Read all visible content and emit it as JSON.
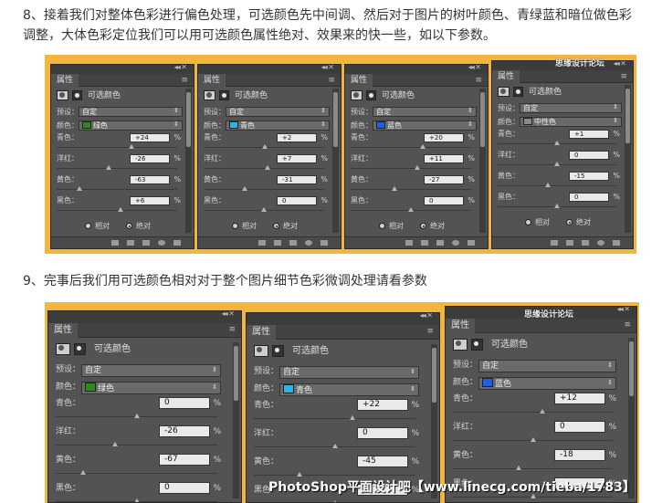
{
  "texts": {
    "step8": "8、接着我们对整体色彩进行偏色处理，可选颜色先中间调、然后对于图片的树叶颜色、青绿蓝和暗位做色彩调整，大体色彩定位我们可以用可选颜色属性绝对、效果来的快一些，如以下参数。",
    "step9": "9、完事后我们用可选颜色相对对于整个图片细节色彩微调处理请看参数"
  },
  "labels": {
    "tab": "属性",
    "title": "可选颜色",
    "preset": "预设：",
    "color": "颜色：",
    "preset_value": "自定",
    "cyan": "青色：",
    "magenta": "洋红：",
    "yellow": "黄色：",
    "black": "黑色：",
    "pct": "%",
    "relative": "相对",
    "absolute": "绝对",
    "menu": "≡",
    "arrows": "◂◂ ✕",
    "dd_arrow": "⇕"
  },
  "panels_top": [
    {
      "color_name": "绿色",
      "swatch": "#2f8a1c",
      "cyan": "+24",
      "magenta": "-26",
      "yellow": "-63",
      "black": "+6",
      "thumbs": [
        0.62,
        0.43,
        0.19,
        0.53
      ],
      "mode": "absolute"
    },
    {
      "color_name": "青色",
      "swatch": "#29b7e6",
      "cyan": "+2",
      "magenta": "+7",
      "yellow": "-31",
      "black": "0",
      "thumbs": [
        0.51,
        0.53,
        0.34,
        0.5
      ],
      "mode": "absolute"
    },
    {
      "color_name": "蓝色",
      "swatch": "#1e5ee8",
      "cyan": "+20",
      "magenta": "+11",
      "yellow": "-27",
      "black": "0",
      "thumbs": [
        0.6,
        0.55,
        0.36,
        0.5
      ],
      "mode": "absolute"
    },
    {
      "color_name": "中性色",
      "swatch": "#8a8a8a",
      "cyan": "+1",
      "magenta": "0",
      "yellow": "-15",
      "black": "0",
      "thumbs": [
        0.5,
        0.5,
        0.42,
        0.5
      ],
      "mode": "absolute"
    }
  ],
  "panels_bottom": [
    {
      "color_name": "绿色",
      "swatch": "#2f8a1c",
      "cyan": "0",
      "magenta": "-26",
      "yellow": "-67",
      "black": "0",
      "thumbs": [
        0.5,
        0.37,
        0.17,
        0.5
      ]
    },
    {
      "color_name": "青色",
      "swatch": "#29b7e6",
      "cyan": "+22",
      "magenta": "0",
      "yellow": "-45",
      "black": "",
      "thumbs": [
        0.61,
        0.5,
        0.28,
        0.5
      ]
    },
    {
      "color_name": "蓝色",
      "swatch": "#1e5ee8",
      "cyan": "+12",
      "magenta": "0",
      "yellow": "-18",
      "black": "",
      "thumbs": [
        0.56,
        0.5,
        0.41,
        0.5
      ]
    }
  ],
  "watermarks": {
    "wm_top": "思缘设计论坛",
    "wm_bottom": "思缘设计论坛",
    "site": "PhotoShop平面设计吧【www.linecg.com/tieba/1783】"
  }
}
